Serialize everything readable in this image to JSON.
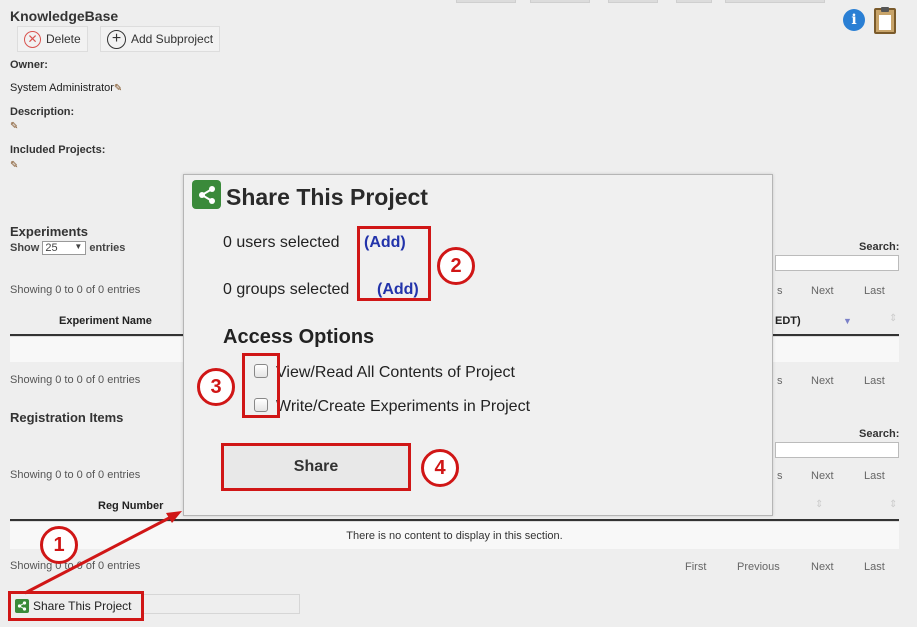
{
  "header": {
    "title": "KnowledgeBase",
    "delete_label": "Delete",
    "add_subproject_label": "Add Subproject"
  },
  "project": {
    "owner_label": "Owner:",
    "owner_value": "System Administrator",
    "description_label": "Description:",
    "included_label": "Included Projects:"
  },
  "experiments": {
    "title": "Experiments",
    "show_label": "Show",
    "entries_value": "25",
    "entries_label": "entries",
    "search_label": "Search:",
    "showing_top": "Showing 0 to 0 of 0 entries",
    "col_name": "Experiment Name",
    "col_date": "EDT)",
    "showing_bottom": "Showing 0 to 0 of 0 entries",
    "pager_s": "s",
    "pager_next": "Next",
    "pager_last": "Last"
  },
  "registration": {
    "title": "Registration Items",
    "search_label": "Search:",
    "showing_top": "Showing 0 to 0 of 0 entries",
    "col_reg": "Reg Number",
    "empty_msg": "There is no content to display in this section.",
    "showing_bottom": "Showing 0 to 0 of 0 entries",
    "pager_s": "s",
    "pager_first": "First",
    "pager_previous": "Previous",
    "pager_next": "Next",
    "pager_last": "Last"
  },
  "share_button_label": "Share This Project",
  "modal": {
    "title": "Share This Project",
    "users_text": "0 users selected",
    "users_add": "(Add)",
    "groups_text": "0 groups selected",
    "groups_add": "(Add)",
    "access_title": "Access Options",
    "option_read": "View/Read All Contents of Project",
    "option_write": "Write/Create Experiments in Project",
    "share_label": "Share"
  },
  "callouts": [
    "1",
    "2",
    "3",
    "4"
  ],
  "colors": {
    "annotation_red": "#d01616",
    "link_blue": "#2233aa",
    "share_green": "#3a8a3a",
    "info_blue": "#2a7fd4"
  }
}
